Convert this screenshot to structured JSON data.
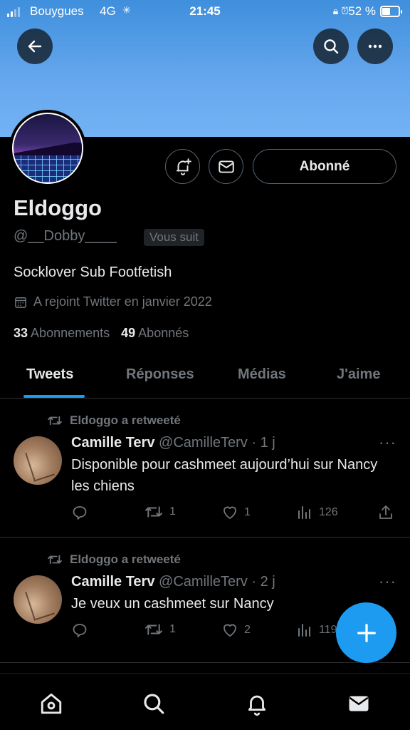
{
  "status_bar": {
    "carrier": "Bouygues",
    "network": "4G",
    "time": "21:45",
    "battery_percent": "52 %",
    "battery_level": 0.52
  },
  "header": {
    "back_icon": "arrow-left-icon",
    "search_icon": "search-icon",
    "more_icon": "more-horizontal-icon"
  },
  "profile": {
    "name": "Eldoggo",
    "handle": "@__Dobby____",
    "follows_you": "Vous suit",
    "bio": "Socklover Sub Footfetish",
    "joined": "A rejoint Twitter en janvier 2022",
    "following_count": "33",
    "following_label": "Abonnements",
    "followers_count": "49",
    "followers_label": "Abonnés",
    "follow_button": "Abonné"
  },
  "tabs": [
    {
      "label": "Tweets",
      "active": true
    },
    {
      "label": "Réponses",
      "active": false
    },
    {
      "label": "Médias",
      "active": false
    },
    {
      "label": "J'aime",
      "active": false
    }
  ],
  "tweets": [
    {
      "retweet_label": "Eldoggo a retweeté",
      "author": "Camille Terv",
      "meta": "@CamilleTerv · 1 j",
      "text": "Disponible pour cashmeet aujourd’hui sur Nancy les chiens",
      "replies": "",
      "retweets": "1",
      "likes": "1",
      "views": "126"
    },
    {
      "retweet_label": "Eldoggo a retweeté",
      "author": "Camille Terv",
      "meta": "@CamilleTerv · 2 j",
      "text": "Je veux un cashmeet sur Nancy",
      "replies": "",
      "retweets": "1",
      "likes": "2",
      "views": "119"
    }
  ],
  "colors": {
    "accent": "#1d9bf0",
    "banner": "#66a8ef",
    "muted": "#71767b",
    "text": "#e7e9ea",
    "background": "#000000"
  }
}
